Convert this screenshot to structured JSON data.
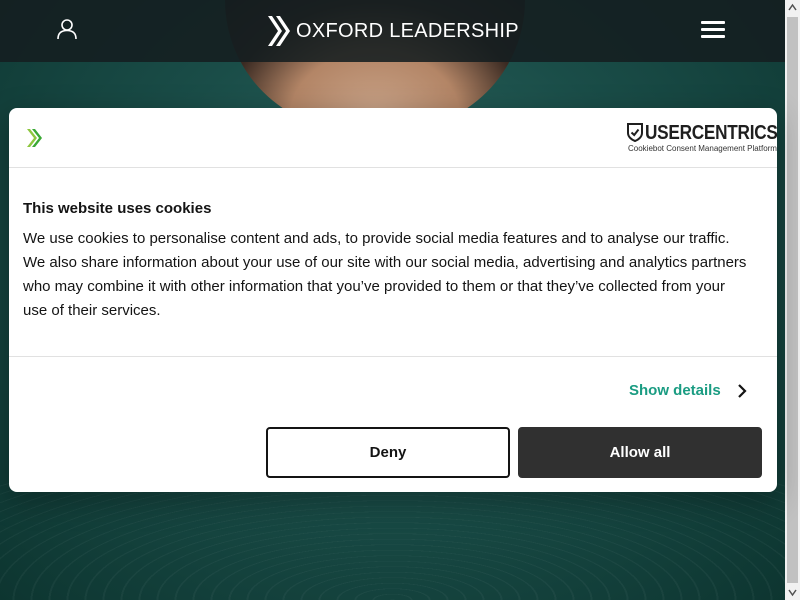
{
  "site": {
    "logo_text": "OXFORD LEADERSHIP",
    "icons": [
      "user-icon",
      "logo-chevron-icon",
      "hamburger-menu-icon"
    ]
  },
  "consent": {
    "provider_name": "USERCENTRICS",
    "provider_tagline": "Cookiebot Consent Management Platform",
    "title": "This website uses cookies",
    "body": "We use cookies to personalise content and ads, to provide social media features and to analyse our traffic. We also share information about your use of our site with our social media, advertising and analytics partners who may combine it with other information that you’ve provided to them or that they’ve collected from your use of their services.",
    "details_label": "Show details",
    "deny_label": "Deny",
    "allow_label": "Allow all"
  },
  "colors": {
    "accent_link": "#1a9c82",
    "button_dark": "#141414",
    "topbar": "#141e20",
    "hero_bg": "#1a4d48",
    "brand_green": "#8dc63f"
  }
}
